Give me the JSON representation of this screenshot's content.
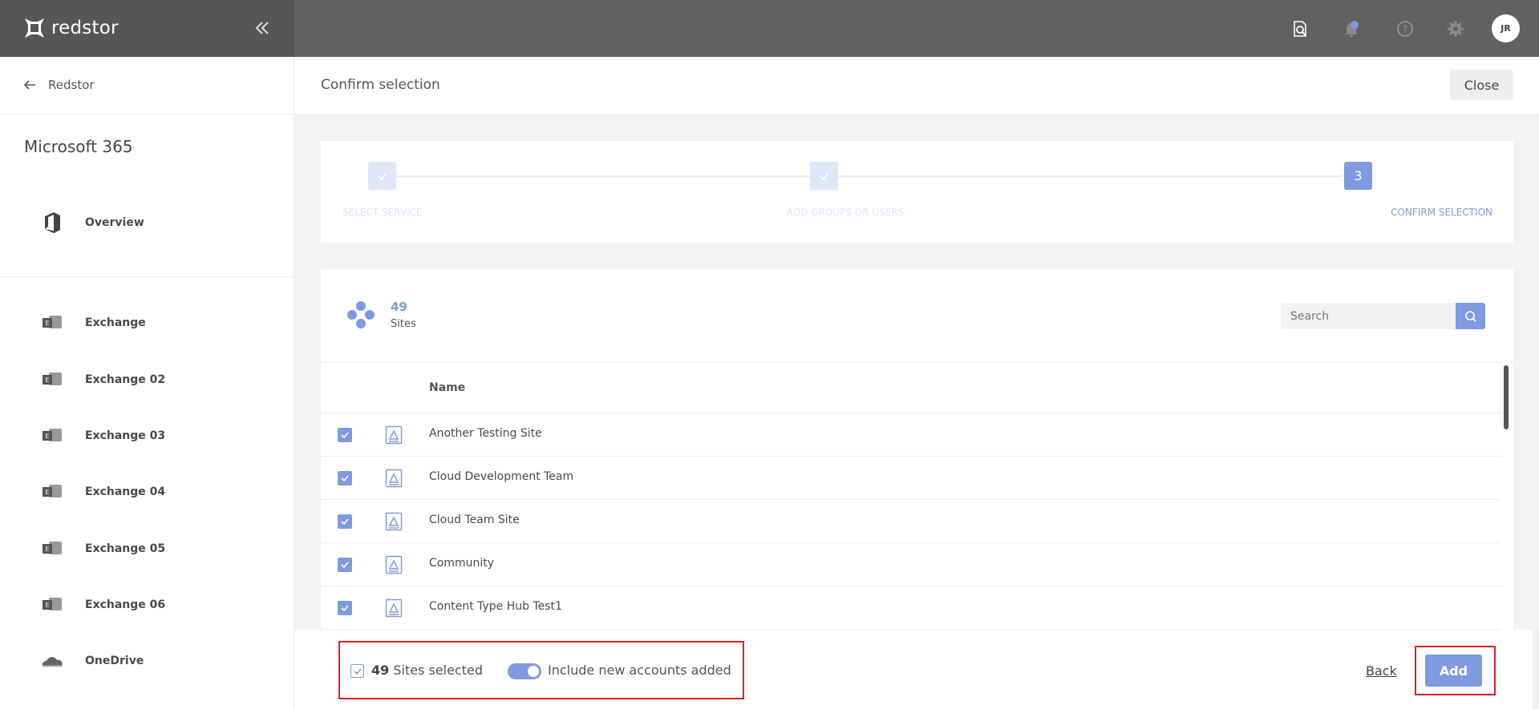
{
  "topbar": {
    "brand": "redstor",
    "avatar_initials": "JR",
    "icons": [
      "search-document-icon",
      "bell-icon",
      "help-icon",
      "gear-icon"
    ]
  },
  "sidebar": {
    "back_label": "Redstor",
    "tenant_title": "Microsoft 365",
    "overview_label": "Overview",
    "items": [
      {
        "label": "Exchange",
        "icon": "exchange-icon"
      },
      {
        "label": "Exchange 02",
        "icon": "exchange-icon"
      },
      {
        "label": "Exchange 03",
        "icon": "exchange-icon"
      },
      {
        "label": "Exchange 04",
        "icon": "exchange-icon"
      },
      {
        "label": "Exchange 05",
        "icon": "exchange-icon"
      },
      {
        "label": "Exchange 06",
        "icon": "exchange-icon"
      },
      {
        "label": "OneDrive",
        "icon": "onedrive-icon"
      }
    ]
  },
  "main": {
    "title": "Confirm selection",
    "close_label": "Close",
    "steps": [
      {
        "label": "SELECT SERVICE",
        "state": "done"
      },
      {
        "label": "ADD GROUPS OR USERS",
        "state": "done"
      },
      {
        "label": "CONFIRM SELECTION",
        "state": "active",
        "number": "3"
      }
    ],
    "panel": {
      "count": "49",
      "count_label": "Sites",
      "search_placeholder": "Search",
      "column_name": "Name",
      "rows": [
        {
          "name": "Another Testing Site",
          "checked": true
        },
        {
          "name": "Cloud Development Team",
          "checked": true
        },
        {
          "name": "Cloud Team Site",
          "checked": true
        },
        {
          "name": "Community",
          "checked": true
        },
        {
          "name": "Content Type Hub Test1",
          "checked": true
        }
      ]
    }
  },
  "footer": {
    "selected_count": "49",
    "selected_suffix": " Sites selected",
    "toggle_label": "Include new accounts added",
    "toggle_on": true,
    "back_label": "Back",
    "add_label": "Add"
  },
  "colors": {
    "accent": "#7f9ade",
    "topbar": "#616161",
    "highlight": "#e02020"
  }
}
